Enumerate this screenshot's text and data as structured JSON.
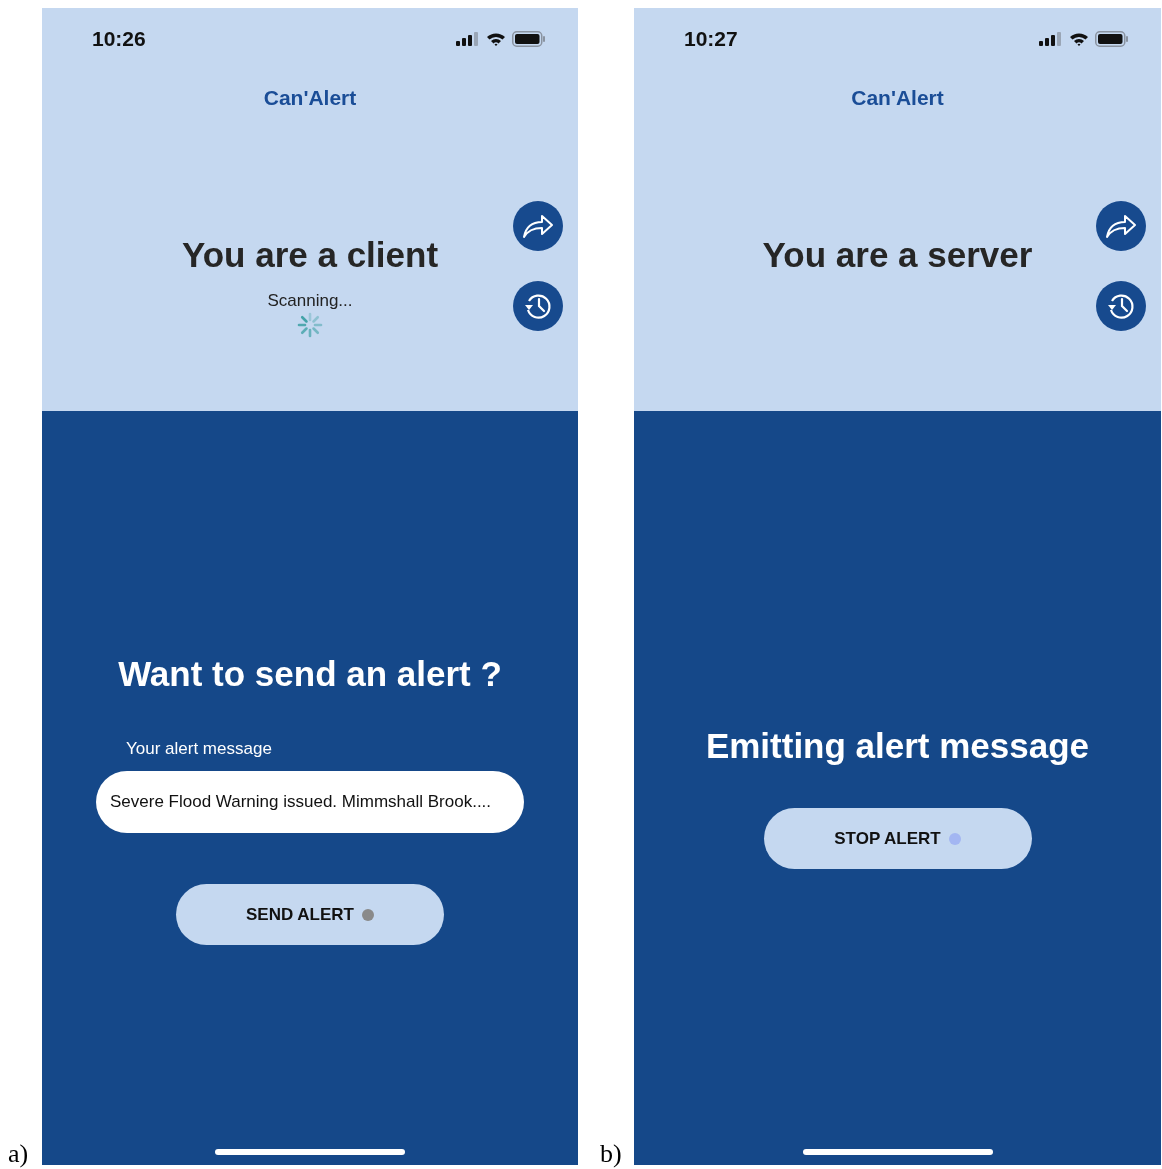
{
  "figures": [
    {
      "label": "a)",
      "screen": {
        "time": "10:26",
        "app_title": "Can'Alert",
        "role_title": "You are a client",
        "status_text": "Scanning...",
        "scanning": true,
        "bottom": {
          "kind": "compose",
          "heading": "Want to send an alert ?",
          "field_label": "Your alert message",
          "field_value": "Severe Flood Warning issued. Mimmshall Brook....",
          "button": {
            "label": "SEND ALERT",
            "active": false
          }
        }
      }
    },
    {
      "label": "b)",
      "screen": {
        "time": "10:27",
        "app_title": "Can'Alert",
        "role_title": "You are a server",
        "scanning": false,
        "bottom": {
          "kind": "emitting",
          "heading": "Emitting alert message",
          "button": {
            "label": "STOP ALERT",
            "active": true
          }
        }
      }
    }
  ]
}
